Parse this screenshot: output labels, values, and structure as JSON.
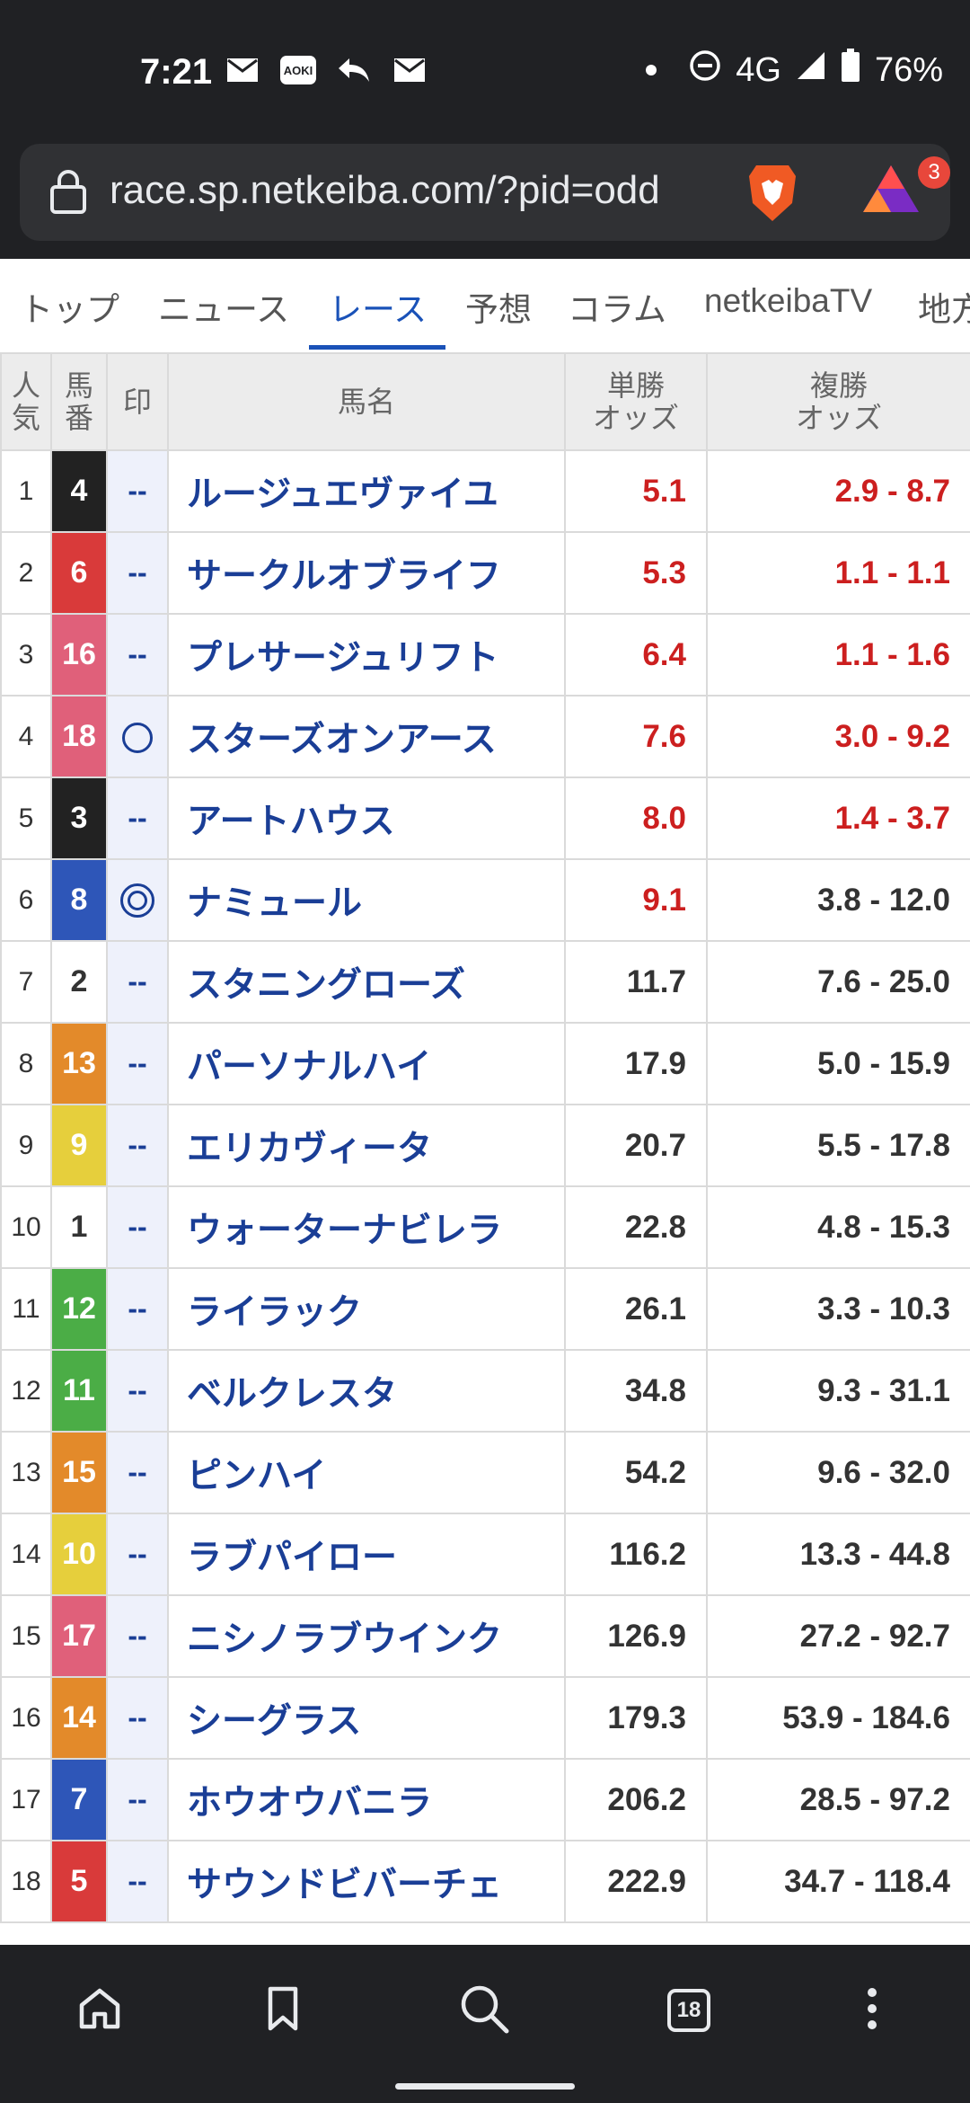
{
  "status_bar": {
    "time": "7:21",
    "aoki_label": "AOKI",
    "network": "4G",
    "battery": "76%"
  },
  "browser": {
    "url": "race.sp.netkeiba.com/?pid=odd",
    "rewards_badge": "3",
    "tab_count": "18"
  },
  "nav": {
    "tabs": [
      {
        "label": "トップ"
      },
      {
        "label": "ニュース"
      },
      {
        "label": "レース"
      },
      {
        "label": "予想"
      },
      {
        "label": "コラム"
      },
      {
        "label": "netkeibaTV"
      },
      {
        "label": "地方"
      }
    ],
    "active_index": 2
  },
  "table": {
    "headers": {
      "ninki": "人\n気",
      "umaban": "馬\n番",
      "mark": "印",
      "name": "馬名",
      "win": "単勝\nオッズ",
      "place": "複勝\nオッズ"
    },
    "rows": [
      {
        "ninki": "1",
        "umaban": "4",
        "frame_color": "#222222",
        "mark": "--",
        "name": "ルージュエヴァイユ",
        "win": "5.1",
        "place": "2.9 - 8.7",
        "win_fav": true,
        "place_fav": true
      },
      {
        "ninki": "2",
        "umaban": "6",
        "frame_color": "#d93a3a",
        "mark": "--",
        "name": "サークルオブライフ",
        "win": "5.3",
        "place": "1.1 - 1.1",
        "win_fav": true,
        "place_fav": true
      },
      {
        "ninki": "3",
        "umaban": "16",
        "frame_color": "#e0607a",
        "mark": "--",
        "name": "プレサージュリフト",
        "win": "6.4",
        "place": "1.1 - 1.6",
        "win_fav": true,
        "place_fav": true
      },
      {
        "ninki": "4",
        "umaban": "18",
        "frame_color": "#e0607a",
        "mark": "○",
        "name": "スターズオンアース",
        "win": "7.6",
        "place": "3.0 - 9.2",
        "win_fav": true,
        "place_fav": true
      },
      {
        "ninki": "5",
        "umaban": "3",
        "frame_color": "#222222",
        "mark": "--",
        "name": "アートハウス",
        "win": "8.0",
        "place": "1.4 - 3.7",
        "win_fav": true,
        "place_fav": true
      },
      {
        "ninki": "6",
        "umaban": "8",
        "frame_color": "#2e56b8",
        "mark": "◎",
        "name": "ナミュール",
        "win": "9.1",
        "place": "3.8 - 12.0",
        "win_fav": true,
        "place_fav": false
      },
      {
        "ninki": "7",
        "umaban": "2",
        "frame_color": "#ffffff",
        "mark": "--",
        "name": "スタニングローズ",
        "win": "11.7",
        "place": "7.6 - 25.0",
        "win_fav": false,
        "place_fav": false
      },
      {
        "ninki": "8",
        "umaban": "13",
        "frame_color": "#e38a2a",
        "mark": "--",
        "name": "パーソナルハイ",
        "win": "17.9",
        "place": "5.0 - 15.9",
        "win_fav": false,
        "place_fav": false
      },
      {
        "ninki": "9",
        "umaban": "9",
        "frame_color": "#e6cf3c",
        "mark": "--",
        "name": "エリカヴィータ",
        "win": "20.7",
        "place": "5.5 - 17.8",
        "win_fav": false,
        "place_fav": false
      },
      {
        "ninki": "10",
        "umaban": "1",
        "frame_color": "#ffffff",
        "mark": "--",
        "name": "ウォーターナビレラ",
        "win": "22.8",
        "place": "4.8 - 15.3",
        "win_fav": false,
        "place_fav": false
      },
      {
        "ninki": "11",
        "umaban": "12",
        "frame_color": "#4bad46",
        "mark": "--",
        "name": "ライラック",
        "win": "26.1",
        "place": "3.3 - 10.3",
        "win_fav": false,
        "place_fav": false
      },
      {
        "ninki": "12",
        "umaban": "11",
        "frame_color": "#4bad46",
        "mark": "--",
        "name": "ベルクレスタ",
        "win": "34.8",
        "place": "9.3 - 31.1",
        "win_fav": false,
        "place_fav": false
      },
      {
        "ninki": "13",
        "umaban": "15",
        "frame_color": "#e38a2a",
        "mark": "--",
        "name": "ピンハイ",
        "win": "54.2",
        "place": "9.6 - 32.0",
        "win_fav": false,
        "place_fav": false
      },
      {
        "ninki": "14",
        "umaban": "10",
        "frame_color": "#e6cf3c",
        "mark": "--",
        "name": "ラブパイロー",
        "win": "116.2",
        "place": "13.3 - 44.8",
        "win_fav": false,
        "place_fav": false
      },
      {
        "ninki": "15",
        "umaban": "17",
        "frame_color": "#e0607a",
        "mark": "--",
        "name": "ニシノラブウインク",
        "win": "126.9",
        "place": "27.2 - 92.7",
        "win_fav": false,
        "place_fav": false
      },
      {
        "ninki": "16",
        "umaban": "14",
        "frame_color": "#e38a2a",
        "mark": "--",
        "name": "シーグラス",
        "win": "179.3",
        "place": "53.9 - 184.6",
        "win_fav": false,
        "place_fav": false
      },
      {
        "ninki": "17",
        "umaban": "7",
        "frame_color": "#2e56b8",
        "mark": "--",
        "name": "ホウオウバニラ",
        "win": "206.2",
        "place": "28.5 - 97.2",
        "win_fav": false,
        "place_fav": false
      },
      {
        "ninki": "18",
        "umaban": "5",
        "frame_color": "#d93a3a",
        "mark": "--",
        "name": "サウンドビバーチェ",
        "win": "222.9",
        "place": "34.7 - 118.4",
        "win_fav": false,
        "place_fav": false
      }
    ]
  },
  "bottom_bar": {
    "icons": [
      "home-icon",
      "bookmark-icon",
      "search-icon",
      "tabs-icon",
      "more-icon"
    ]
  }
}
